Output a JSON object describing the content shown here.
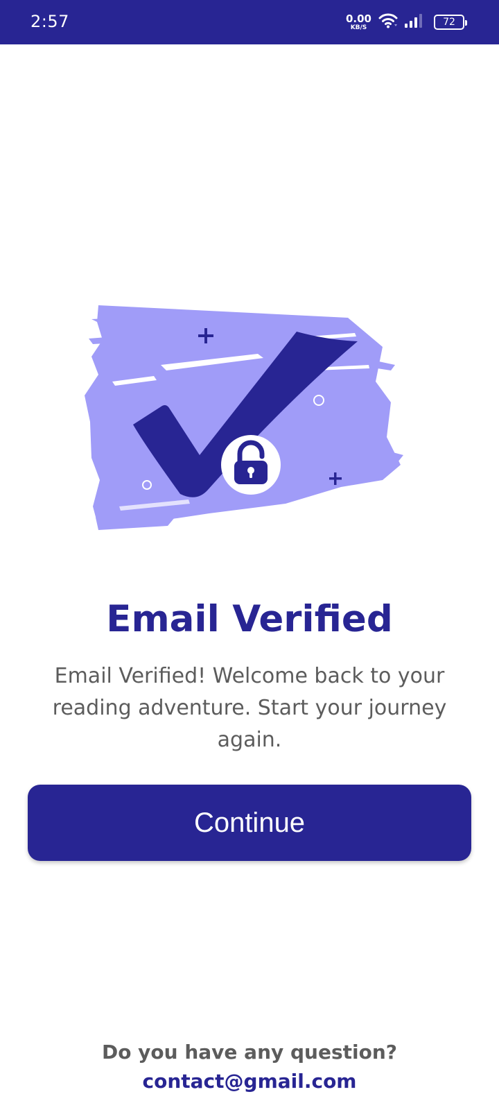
{
  "status_bar": {
    "time": "2:57",
    "net_speed_value": "0.00",
    "net_speed_unit": "KB/S",
    "battery": "72",
    "icons": [
      "wifi-icon",
      "signal-icon",
      "battery-icon"
    ]
  },
  "illustration": {
    "icons": [
      "checkmark-icon",
      "unlocked-padlock-icon"
    ]
  },
  "content": {
    "title": "Email Verified",
    "message": "Email Verified! Welcome back to your reading adventure. Start your journey again.",
    "continue_label": "Continue"
  },
  "footer": {
    "question": "Do you have any question?",
    "contact_email": "contact@gmail.com"
  },
  "colors": {
    "primary": "#282593",
    "brush": "#a09cf8",
    "text_gray": "#5c5c5c",
    "background": "#ffffff"
  }
}
